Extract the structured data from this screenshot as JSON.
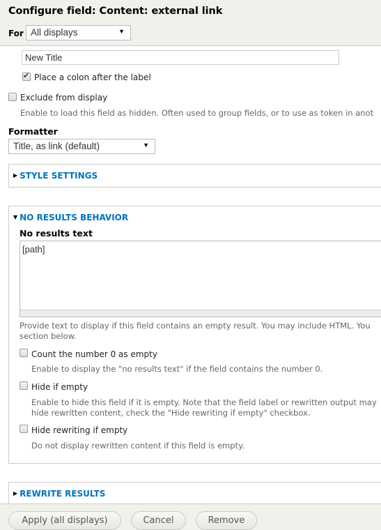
{
  "header": {
    "title": "Configure field: Content: external link",
    "for_label": "For",
    "for_select": {
      "value": "All displays",
      "arrow": "▼"
    }
  },
  "label_input": {
    "value": "New Title"
  },
  "colon_checkbox": {
    "label": "Place a colon after the label",
    "checked": true
  },
  "exclude_checkbox": {
    "label": "Exclude from display",
    "checked": false,
    "description": "Enable to load this field as hidden. Often used to group fields, or to use as token in anot"
  },
  "formatter": {
    "label": "Formatter",
    "value": "Title, as link (default)",
    "arrow": "▼"
  },
  "style_settings": {
    "legend": "STYLE SETTINGS",
    "expanded": false,
    "toggle": "▶"
  },
  "no_results": {
    "legend": "NO RESULTS BEHAVIOR",
    "expanded": true,
    "toggle": "▼",
    "text_label": "No results text",
    "text_value": "[path]",
    "text_description_1": "Provide text to display if this field contains an empty result. You may include HTML. You",
    "text_description_2": "section below.",
    "count_zero": {
      "label": "Count the number 0 as empty",
      "checked": false,
      "description": "Enable to display the \"no results text\" if the field contains the number 0."
    },
    "hide_empty": {
      "label": "Hide if empty",
      "checked": false,
      "description_1": "Enable to hide this field if it is empty. Note that the field label or rewritten output may",
      "description_2": "hide rewritten content, check the \"Hide rewriting if empty\" checkbox."
    },
    "hide_rewriting": {
      "label": "Hide rewriting if empty",
      "checked": false,
      "description": "Do not display rewritten content if this field is empty."
    }
  },
  "rewrite_results": {
    "legend": "REWRITE RESULTS",
    "expanded": false,
    "toggle": "▶"
  },
  "footer": {
    "apply_label": "Apply (all displays)",
    "cancel_label": "Cancel",
    "remove_label": "Remove"
  }
}
